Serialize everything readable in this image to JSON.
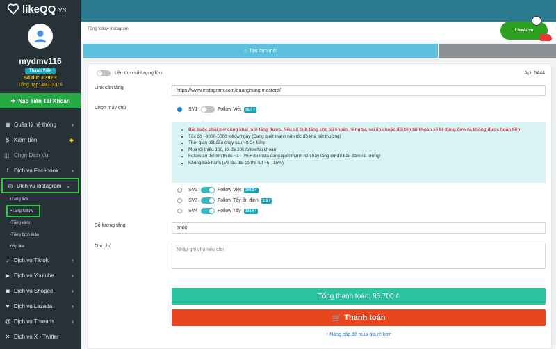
{
  "sidebar": {
    "logo_text": "likeQQ",
    "logo_suffix": "·VN",
    "username": "mydmv116",
    "rank": "Thành Viên",
    "balance": "Số dư: 3.392 ₫",
    "total_topup": "Tổng nạp: 480.000 ₫",
    "topup_button": "Nạp Tiền Tài Khoản",
    "system_menu": [
      {
        "label": "Quản lý hệ thống",
        "icon": "grid-icon"
      },
      {
        "label": "Kiếm tiền",
        "icon": "money-icon"
      }
    ],
    "section_label": "Chọn Dịch Vụ:",
    "services": [
      {
        "label": "Dịch vụ Facebook",
        "icon": "facebook-icon"
      },
      {
        "label": "Dịch vụ Instagram",
        "icon": "instagram-icon"
      }
    ],
    "instagram_sub": [
      "Tăng like",
      "Tăng follow",
      "Tăng view",
      "Tăng bình luận",
      "Vip like"
    ],
    "more_services": [
      {
        "label": "Dịch vụ Tiktok",
        "icon": "tiktok-icon"
      },
      {
        "label": "Dịch vụ Youtube",
        "icon": "youtube-icon"
      },
      {
        "label": "Dịch vụ Shopee",
        "icon": "shopee-icon"
      },
      {
        "label": "Dịch vụ Lazada",
        "icon": "lazada-icon"
      },
      {
        "label": "Dịch vụ Threads",
        "icon": "threads-icon"
      },
      {
        "label": "Dịch vụ X - Twitter",
        "icon": "twitter-icon"
      }
    ]
  },
  "header": {
    "breadcrumb": "Tăng follow instagram",
    "likeai_label": "LikeAi.vn"
  },
  "tabs": {
    "create_order": "Tạo đơn mới"
  },
  "form": {
    "bulk_toggle_label": "Lên đơn số lượng lớn",
    "api_label": "Api: 5444",
    "link_label": "Link cần tăng",
    "link_value": "https://www.instagram.com/quanghung.masterd/",
    "server_label": "Chọn máy chủ",
    "servers": [
      {
        "name": "SV1",
        "desc": "Follow Việt",
        "price": "95.7 ₫",
        "checked": true
      },
      {
        "name": "SV2",
        "desc": "Follow Việt",
        "price": "200.2 ₫",
        "checked": false
      },
      {
        "name": "SV3",
        "desc": "Follow Tây ổn định",
        "price": "111 ₫",
        "checked": false
      },
      {
        "name": "SV4",
        "desc": "Follow Tây",
        "price": "104.4 ₫",
        "checked": false
      }
    ],
    "notes": [
      "Bắt buộc phải mở công khai mới tăng được. Nếu cố tình tăng cho tài khoản riêng tư, sai link hoặc đổi tên tài khoản sẽ bị dừng đơn và không được hoàn tiền",
      "Tốc độ ~3000-5000 follow/ngày (Đang quét mạnh nên tốc độ khá bất thường)",
      "Thời gian bắt đầu chạy sau ~8-24 tiếng",
      "Mua tối thiểu 100, tối đa 20k follow/tài khoản",
      "Follow có thể lên thiếu ~1 - 7%+ do Insta đang quét mạnh nên hãy tăng dư để bảo đảm số lượng!",
      "Không bảo hành (Về lâu dài có thể tụt ~5 - 15%)"
    ],
    "quantity_label": "Số lượng tăng",
    "quantity_value": "1000",
    "note_label": "Ghi chú",
    "note_placeholder": "Nhập ghi chú nếu cần",
    "total_label": "Tổng thanh toán: 95.700 ₫",
    "pay_button": "Thanh toán",
    "upgrade_link": "Nâng cấp để mua giá rẻ hơn"
  },
  "colors": {
    "sidebar_bg": "#263238",
    "topbar_bg": "#2b7a90",
    "accent_green": "#28a745",
    "tab_active": "#5bc0de",
    "total_btn": "#2bc2a0",
    "pay_btn": "#e8461d"
  }
}
